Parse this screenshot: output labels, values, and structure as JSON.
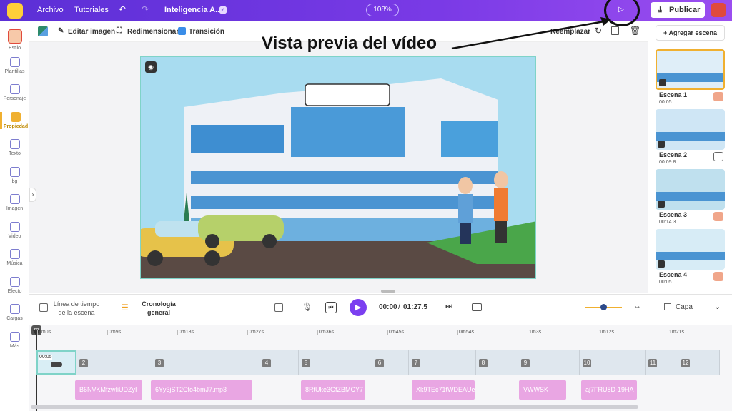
{
  "topbar": {
    "menu_file": "Archivo",
    "menu_tutorials": "Tutoriales",
    "project_title": "Inteligencia A...",
    "zoom": "108%",
    "publish_label": "Publicar"
  },
  "toolbar": {
    "edit_image": "Editar imagen",
    "resize": "Redimensionar",
    "transition": "Transición",
    "replace": "Reemplazar"
  },
  "annotation": {
    "text": "Vista previa del vídeo"
  },
  "sidebar": {
    "items": [
      {
        "label": "Estilo"
      },
      {
        "label": "Plantillas"
      },
      {
        "label": "Personaje"
      },
      {
        "label": "Propiedad"
      },
      {
        "label": "Texto"
      },
      {
        "label": "bg"
      },
      {
        "label": "Imagen"
      },
      {
        "label": "Video"
      },
      {
        "label": "Música"
      },
      {
        "label": "Efecto"
      },
      {
        "label": "Cargas"
      },
      {
        "label": "Más"
      }
    ]
  },
  "scenes": {
    "add_label": "+ Agregar escena",
    "items": [
      {
        "label": "Escena 1",
        "time": "00:05"
      },
      {
        "label": "Escena 2",
        "time": "00:09.8"
      },
      {
        "label": "Escena 3",
        "time": "00:14.3"
      },
      {
        "label": "Escena 4",
        "time": "00:05"
      }
    ]
  },
  "timeline_bar": {
    "scene_timeline": "Línea de tiempo\nde la escena",
    "general_timeline": "Cronología\ngeneral",
    "current_time": "00:00",
    "separator": "/",
    "total_time": "01:27.5",
    "layer_label": "Capa"
  },
  "timeline": {
    "ticks": [
      "0m0s",
      "0m9s",
      "0m18s",
      "0m27s",
      "0m36s",
      "0m45s",
      "0m54s",
      "1m3s",
      "1m12s",
      "1m21s"
    ],
    "first_clip_time": "00:05",
    "clip_numbers": [
      "2",
      "3",
      "4",
      "5",
      "6",
      "7",
      "8",
      "9",
      "10",
      "11",
      "12"
    ],
    "audio_clips": [
      "B6NVKMfzwIiUDZyI",
      "6Yy3jST2Cfo4bmJ7.mp3",
      "8RtUke3GfZBMCY7",
      "Xk9TEc71tWDEAUe",
      "VWWSK",
      "aj7FRU8D-19HA"
    ]
  },
  "colors": {
    "accent": "#6a35e0",
    "play": "#7b3ff0",
    "annotation_circle": "#111111"
  }
}
